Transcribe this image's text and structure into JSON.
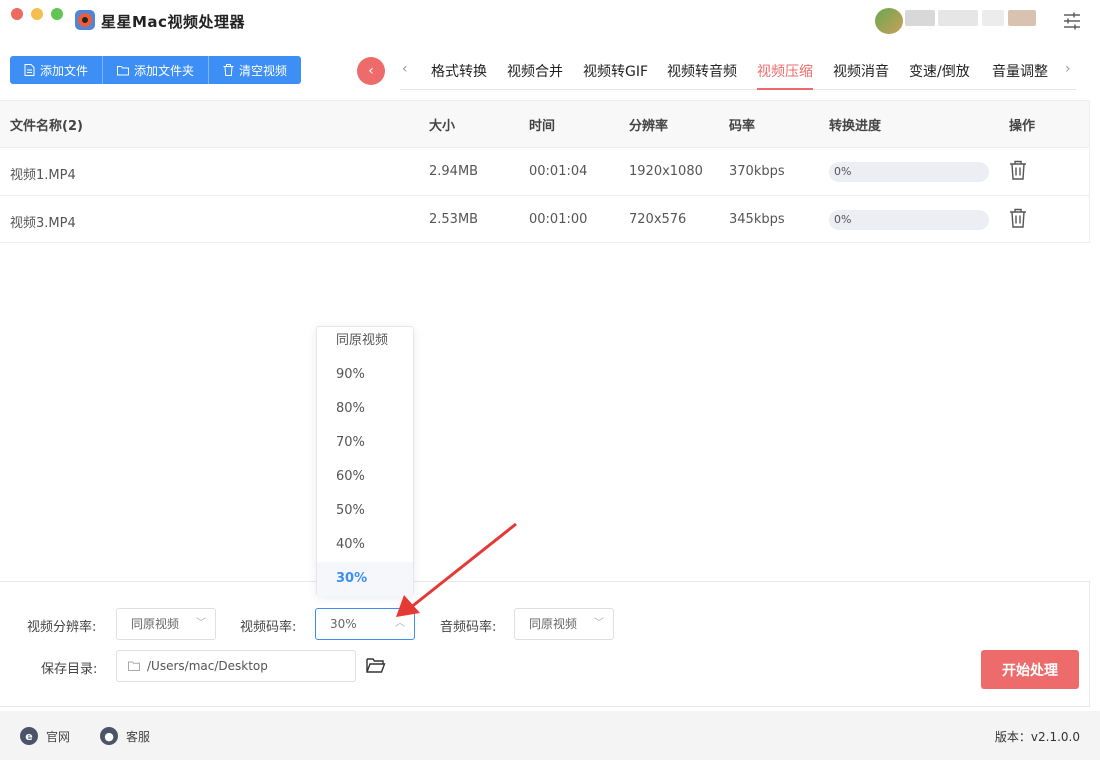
{
  "app": {
    "title": "星星Mac视频处理器"
  },
  "toolbar": {
    "add_file": "添加文件",
    "add_folder": "添加文件夹",
    "clear": "清空视频"
  },
  "tabs": [
    {
      "label": "格式转换"
    },
    {
      "label": "视频合并"
    },
    {
      "label": "视频转GIF"
    },
    {
      "label": "视频转音频"
    },
    {
      "label": "视频压缩",
      "active": true
    },
    {
      "label": "视频消音"
    },
    {
      "label": "变速/倒放"
    },
    {
      "label": "音量调整"
    }
  ],
  "table": {
    "headers": {
      "name": "文件名称(2)",
      "size": "大小",
      "time": "时间",
      "res": "分辨率",
      "bitrate": "码率",
      "progress": "转换进度",
      "ops": "操作"
    },
    "rows": [
      {
        "name": "视频1.MP4",
        "size": "2.94MB",
        "time": "00:01:04",
        "res": "1920x1080",
        "bitrate": "370kbps",
        "progress": "0%"
      },
      {
        "name": "视频3.MP4",
        "size": "2.53MB",
        "time": "00:01:00",
        "res": "720x576",
        "bitrate": "345kbps",
        "progress": "0%"
      }
    ]
  },
  "dropdown": {
    "options": [
      "同原视频",
      "90%",
      "80%",
      "70%",
      "60%",
      "50%",
      "40%",
      "30%"
    ],
    "selected": "30%"
  },
  "settings": {
    "res_label": "视频分辨率:",
    "res_value": "同原视频",
    "vbitrate_label": "视频码率:",
    "vbitrate_value": "30%",
    "abitrate_label": "音频码率:",
    "abitrate_value": "同原视频",
    "save_label": "保存目录:",
    "save_path": "/Users/mac/Desktop",
    "start": "开始处理"
  },
  "footer": {
    "website": "官网",
    "support": "客服",
    "version": "版本：v2.1.0.0"
  },
  "colors": {
    "accent_blue": "#3d8ff5",
    "accent_red": "#ee6b6b"
  }
}
